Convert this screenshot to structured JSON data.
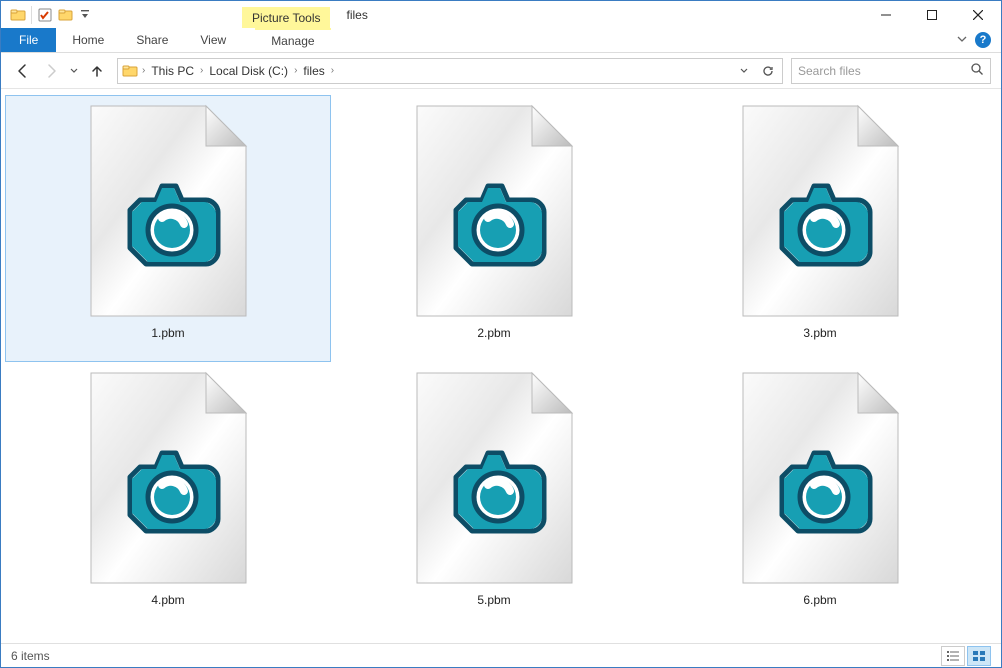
{
  "titlebar": {
    "context_tab": "Picture Tools",
    "title": "files"
  },
  "ribbon": {
    "file": "File",
    "tabs": [
      "Home",
      "Share",
      "View"
    ],
    "context_tab": "Manage"
  },
  "nav": {
    "breadcrumb": [
      "This PC",
      "Local Disk (C:)",
      "files"
    ],
    "search_placeholder": "Search files"
  },
  "files": [
    {
      "name": "1.pbm",
      "selected": true
    },
    {
      "name": "2.pbm",
      "selected": false
    },
    {
      "name": "3.pbm",
      "selected": false
    },
    {
      "name": "4.pbm",
      "selected": false
    },
    {
      "name": "5.pbm",
      "selected": false
    },
    {
      "name": "6.pbm",
      "selected": false
    }
  ],
  "status": {
    "count": "6 items"
  }
}
